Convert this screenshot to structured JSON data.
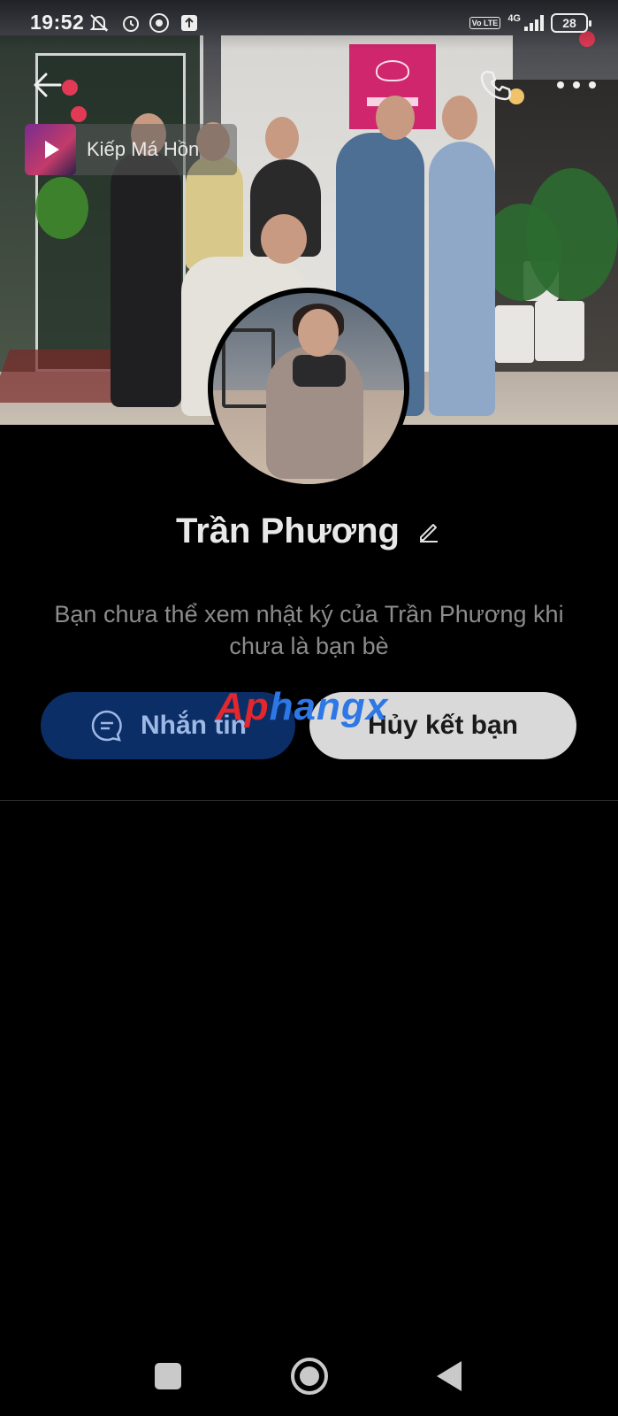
{
  "status_bar": {
    "time": "19:52",
    "network": "4G",
    "volte": "Vo LTE",
    "battery": "28"
  },
  "header": {
    "music_title": "Kiếp Má Hồn"
  },
  "profile": {
    "name": "Trần Phương",
    "notice": "Bạn chưa thể xem nhật ký của Trần Phương khi chưa là bạn bè"
  },
  "actions": {
    "message_label": "Nhắn tin",
    "unfriend_label": "Hủy kết bạn"
  },
  "watermark": {
    "part1": "Ap",
    "part2": "hangx"
  },
  "icons": {
    "back": "arrow-left-icon",
    "call": "phone-icon",
    "more": "more-dots-icon",
    "edit": "pencil-icon",
    "message": "chat-bubble-icon"
  },
  "colors": {
    "message_button": "#0b2e66",
    "unfriend_button": "#d9d9d9",
    "background": "#000000"
  }
}
